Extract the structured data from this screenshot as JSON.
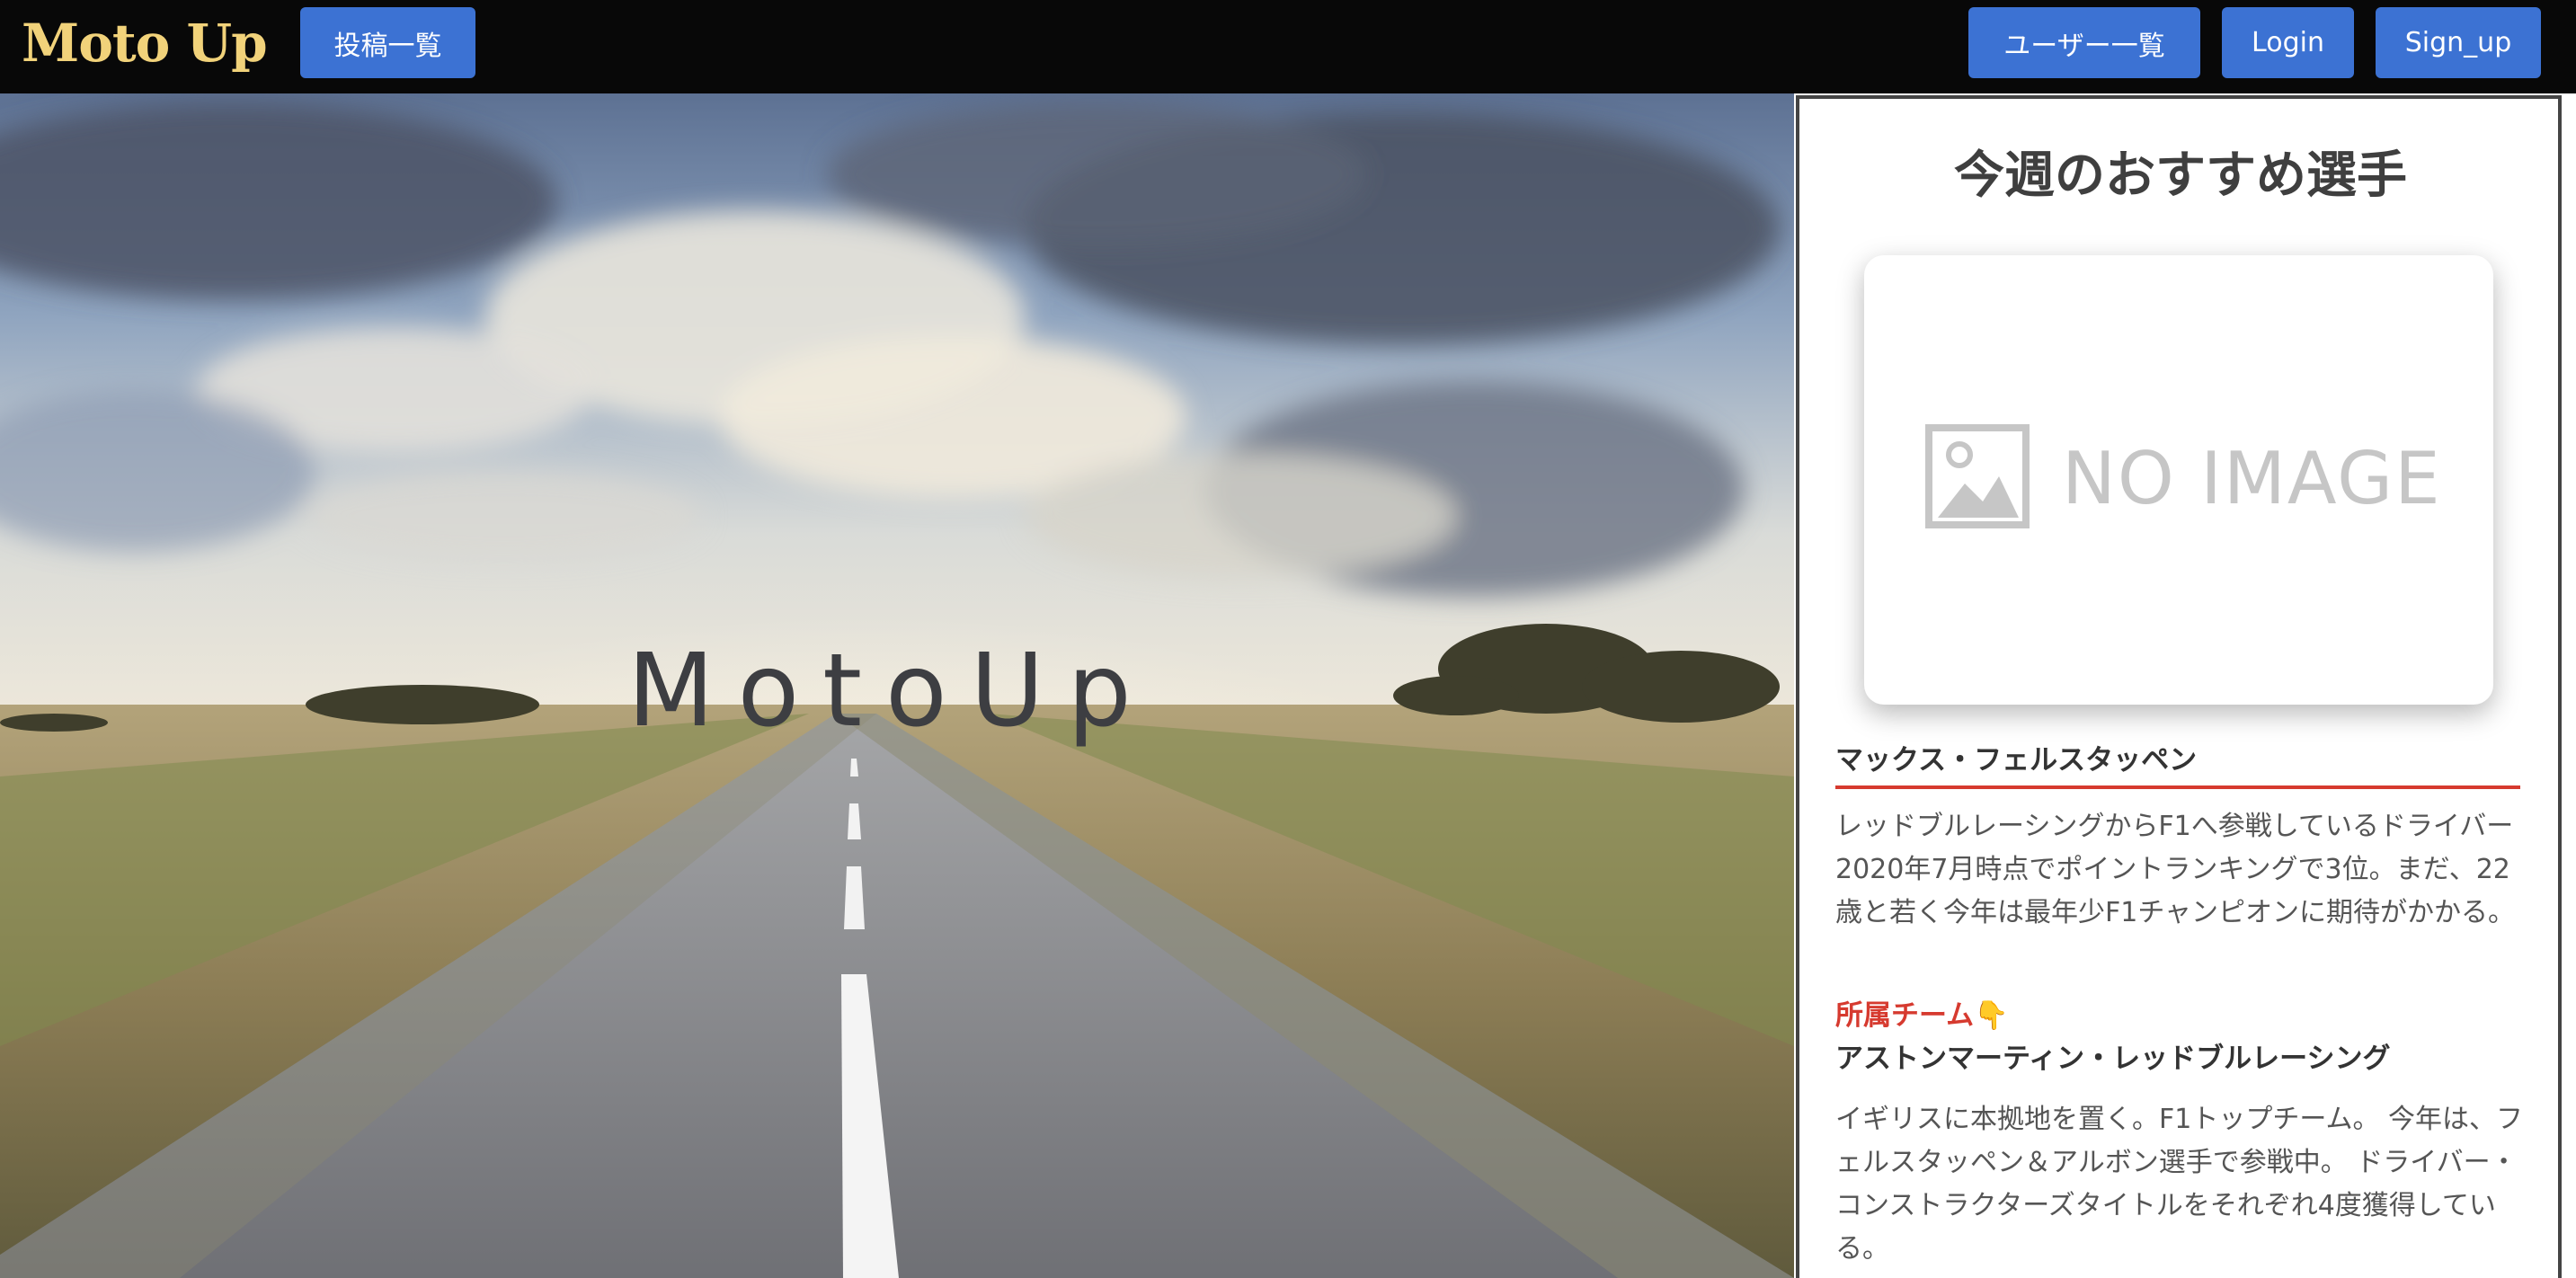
{
  "header": {
    "logo": "Moto Up",
    "posts_button": "投稿一覧",
    "users_button": "ユーザー一覧",
    "login_button": "Login",
    "signup_button": "Sign_up"
  },
  "hero": {
    "title": "MotoUp"
  },
  "recommendation": {
    "heading": "今週のおすすめ選手",
    "image_placeholder": "NO IMAGE",
    "player_name": "マックス・フェルスタッペン",
    "description": "レッドブルレーシングからF1へ参戦しているドライバー 2020年7月時点でポイントランキングで3位。まだ、22歳と若く今年は最年少F1チャンピオンに期待がかかる。",
    "team_label": "所属チーム👇",
    "team_name": "アストンマーティン・レッドブルレーシング",
    "team_description": "イギリスに本拠地を置く。F1トップチーム。 今年は、フェルスタッペン＆アルボン選手で参戦中。 ドライバー・コンストラクターズタイトルをそれぞれ4度獲得している。"
  },
  "colors": {
    "header_bg": "#080808",
    "logo": "#f1d27a",
    "button": "#3c72d3",
    "accent_red": "#d63a2f",
    "panel_border": "#444444"
  },
  "icons": {
    "placeholder": "image-icon"
  }
}
